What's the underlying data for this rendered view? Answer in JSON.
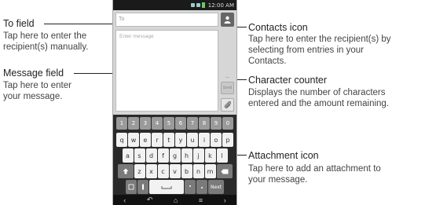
{
  "callouts": {
    "to_field": {
      "title": "To field",
      "desc_line1": "Tap here to enter the",
      "desc_line2": "recipient(s) manually."
    },
    "message_field": {
      "title": "Message field",
      "desc_line1": "Tap here to enter",
      "desc_line2": "your message."
    },
    "contacts_icon": {
      "title": "Contacts icon",
      "desc_line1": "Tap here to enter the recipient(s) by",
      "desc_line2": "selecting from entries in your",
      "desc_line3": "Contacts."
    },
    "character_counter": {
      "title": "Character counter",
      "desc_line1": "Displays the number of characters",
      "desc_line2": "entered and the amount remaining."
    },
    "attachment_icon": {
      "title": "Attachment icon",
      "desc_line1": "Tap here to add an attachment to",
      "desc_line2": "your message."
    }
  },
  "phone": {
    "status_time": "12:00 AM",
    "to_placeholder": "To",
    "message_placeholder": "Enter message",
    "counter_text": "---",
    "send_label": "Send",
    "keyboard": {
      "numbers": [
        "1",
        "2",
        "3",
        "4",
        "5",
        "6",
        "7",
        "8",
        "9",
        "0"
      ],
      "row1": [
        "q",
        "w",
        "e",
        "r",
        "t",
        "y",
        "u",
        "i",
        "o",
        "p"
      ],
      "row2": [
        "a",
        "s",
        "d",
        "f",
        "g",
        "h",
        "j",
        "k",
        "l"
      ],
      "row3": [
        "z",
        "x",
        "c",
        "v",
        "b",
        "n",
        "m"
      ],
      "next_label": "Next"
    }
  }
}
